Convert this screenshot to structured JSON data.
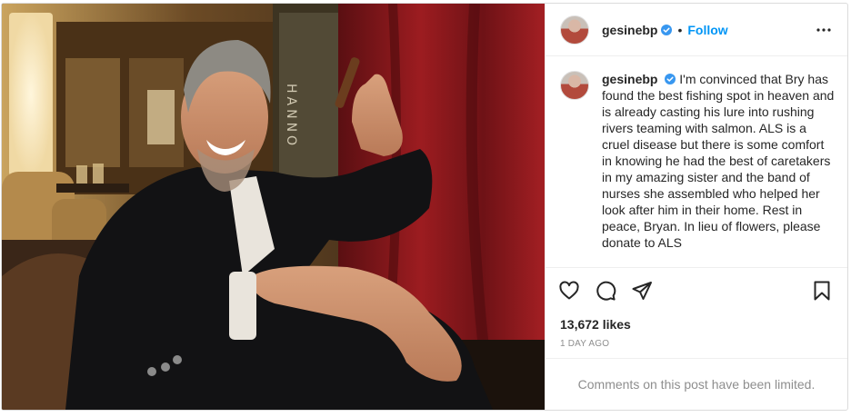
{
  "post": {
    "username": "gesinebp",
    "verified": true,
    "follow_label": "Follow",
    "separator": "•",
    "more_icon": "more-options-icon",
    "caption": "I'm convinced that Bry has found the best fishing spot in heaven and is already casting his lure into rushing rivers teaming with salmon. ALS is a cruel disease but there is some comfort in knowing he had the best of caretakers in my amazing sister and the band of nurses she assembled who helped her look after him in their home. Rest in peace, Bryan. In lieu of flowers, please donate to ALS",
    "likes": "13,672 likes",
    "time_ago": "1 DAY AGO",
    "comments_limited": "Comments on this post have been limited."
  },
  "photo": {
    "sign_letters": "HANNO"
  },
  "colors": {
    "accent": "#0095f6",
    "muted": "#8e8e8e",
    "text": "#262626",
    "verified": "#3897f0"
  }
}
